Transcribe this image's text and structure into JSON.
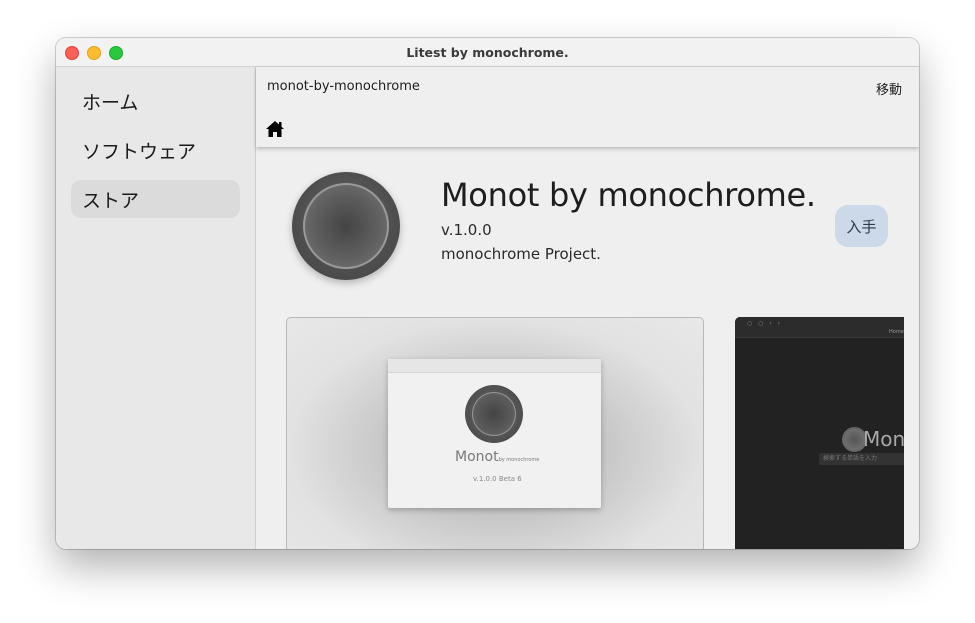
{
  "window": {
    "title": "Litest by monochrome."
  },
  "sidebar": {
    "items": [
      {
        "label": "ホーム",
        "active": false
      },
      {
        "label": "ソフトウェア",
        "active": false
      },
      {
        "label": "ストア",
        "active": true
      }
    ]
  },
  "toolbar": {
    "url": "monot-by-monochrome",
    "go_label": "移動",
    "home_icon": "home-icon"
  },
  "app": {
    "name": "Monot by monochrome.",
    "version": "v.1.0.0",
    "developer": "monochrome Project.",
    "get_label": "入手",
    "get_button_color": "#cbd9e8"
  },
  "screenshots": [
    {
      "mini_title": "Monot",
      "mini_sub": "by monochrome",
      "mini_version": "v.1.0.0 Beta 6"
    },
    {
      "mini_title": "Mono",
      "mini_nav": "Home",
      "mini_search": "検索する単語を入力"
    }
  ]
}
